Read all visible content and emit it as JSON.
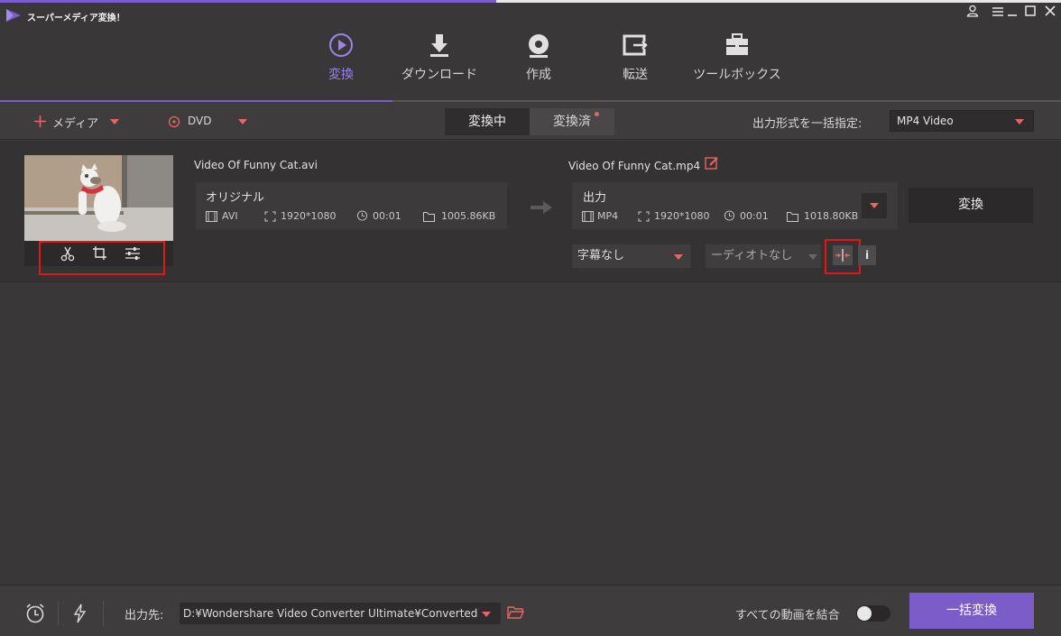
{
  "app": {
    "title": "スーパーメディア変換！"
  },
  "window_controls": [
    "user-icon",
    "menu-icon",
    "minimize-icon",
    "maximize-icon",
    "close-icon"
  ],
  "nav": {
    "tabs": [
      {
        "label": "変換",
        "icon": "convert-icon",
        "active": true
      },
      {
        "label": "ダウンロード",
        "icon": "download-icon",
        "active": false
      },
      {
        "label": "作成",
        "icon": "disc-icon",
        "active": false
      },
      {
        "label": "転送",
        "icon": "transfer-icon",
        "active": false
      },
      {
        "label": "ツールボックス",
        "icon": "toolbox-icon",
        "active": false
      }
    ]
  },
  "toolbar": {
    "add_media_label": "メディア",
    "dvd_label": "DVD",
    "tab_converting": "変換中",
    "tab_converted": "変換済",
    "output_format_label": "出力形式を一括指定:",
    "output_format_value": "MP4 Video"
  },
  "item": {
    "source": {
      "filename": "Video Of Funny Cat.avi",
      "title": "オリジナル",
      "format": "AVI",
      "resolution": "1920*1080",
      "duration": "00:01",
      "size": "1005.86KB"
    },
    "output": {
      "filename": "Video Of Funny Cat.mp4",
      "title": "出力",
      "format": "MP4",
      "resolution": "1920*1080",
      "duration": "00:01",
      "size": "1018.80KB"
    },
    "convert_label": "変換",
    "subtitle_value": "字幕なし",
    "audio_value": "ーディオトなし",
    "info_label": "i"
  },
  "bottom": {
    "output_label": "出力先:",
    "output_path": "D:¥Wondershare Video Converter Ultimate¥Converted",
    "merge_label": "すべての動画を結合",
    "batch_convert_label": "一括変換"
  },
  "colors": {
    "accent": "#7b5cc9",
    "highlight": "#e8665f",
    "annotation": "#e01818"
  }
}
